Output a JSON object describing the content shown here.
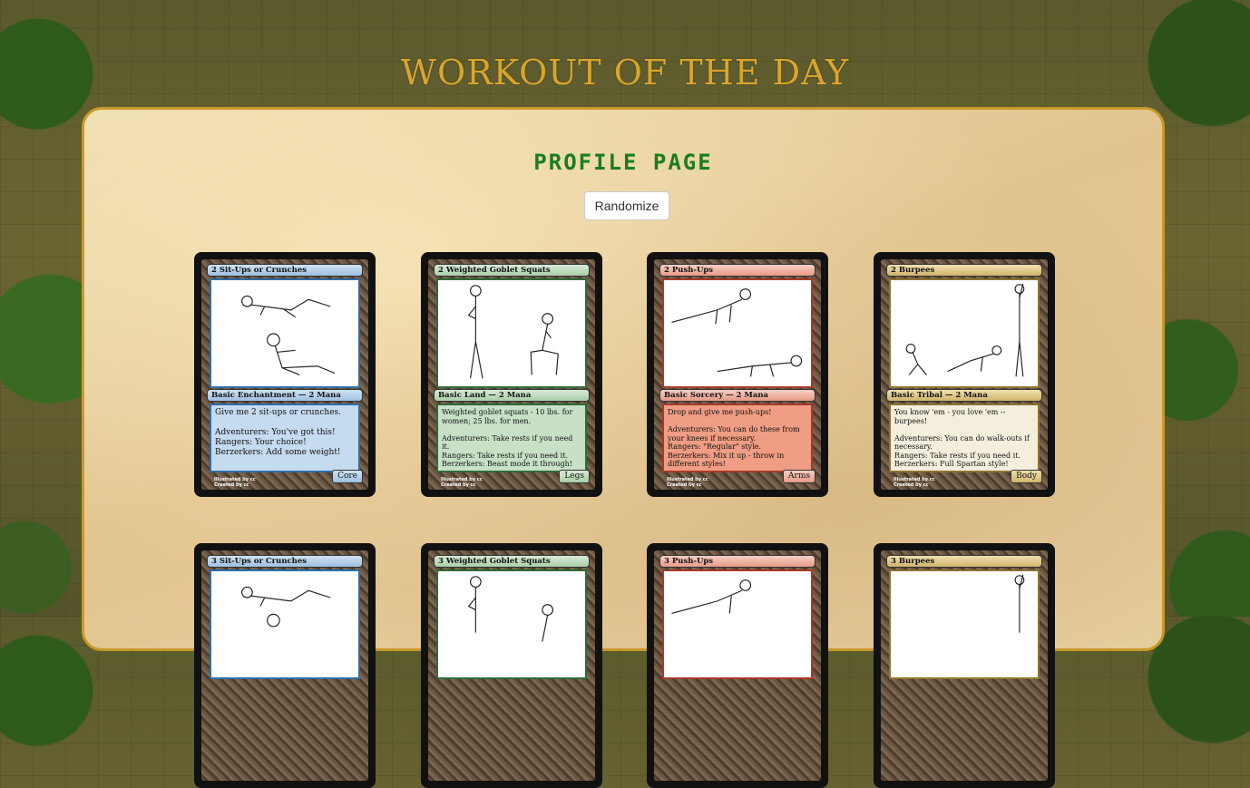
{
  "site": {
    "title": "WORKOUT OF THE DAY"
  },
  "page": {
    "heading": "PROFILE PAGE",
    "randomize_label": "Randomize"
  },
  "cards": [
    {
      "title": "2 Sit-Ups or Crunches",
      "type": "Basic Enchantment —  2 Mana",
      "body": "Give me 2 sit-ups or crunches.\n\nAdventurers: You've got this!\nRangers: Your choice!\nBerzerkers: Add some weight!",
      "tag": "Core",
      "credit1": "Illustrated by cc",
      "credit2": "Created by cc",
      "color": "blue"
    },
    {
      "title": "2 Weighted Goblet Squats",
      "type": "Basic Land —  2 Mana",
      "body": "Weighted goblet squats - 10 lbs. for women; 25 lbs. for men.\n\nAdventurers: Take rests if you need it.\nRangers: Take rests if you need it.\nBerzerkers: Beast mode it through!",
      "tag": "Legs",
      "credit1": "Illustrated by cc",
      "credit2": "Created by cc",
      "color": "green"
    },
    {
      "title": "2 Push-Ups",
      "type": "Basic Sorcery —  2 Mana",
      "body": "Drop and give me push-ups!\n\nAdventurers: You can do these from your knees if necessary.\nRangers: \"Regular\" style.\nBerzerkers: Mix it up - throw in different styles!",
      "tag": "Arms",
      "credit1": "Illustrated by cc",
      "credit2": "Created by cc",
      "color": "red"
    },
    {
      "title": "2 Burpees",
      "type": "Basic Tribal —  2 Mana",
      "body": "You know 'em - you love 'em -- burpees!\n\nAdventurers: You can do walk-outs if necessary.\nRangers: Take rests if you need it.\nBerzerkers: Full Spartan style!",
      "tag": "Body",
      "credit1": "Illustrated by cc",
      "credit2": "Created by cc",
      "color": "gold"
    },
    {
      "title": "3 Sit-Ups or Crunches",
      "color": "blue"
    },
    {
      "title": "3 Weighted Goblet Squats",
      "color": "green"
    },
    {
      "title": "3 Push-Ups",
      "color": "red"
    },
    {
      "title": "3 Burpees",
      "color": "gold"
    }
  ]
}
